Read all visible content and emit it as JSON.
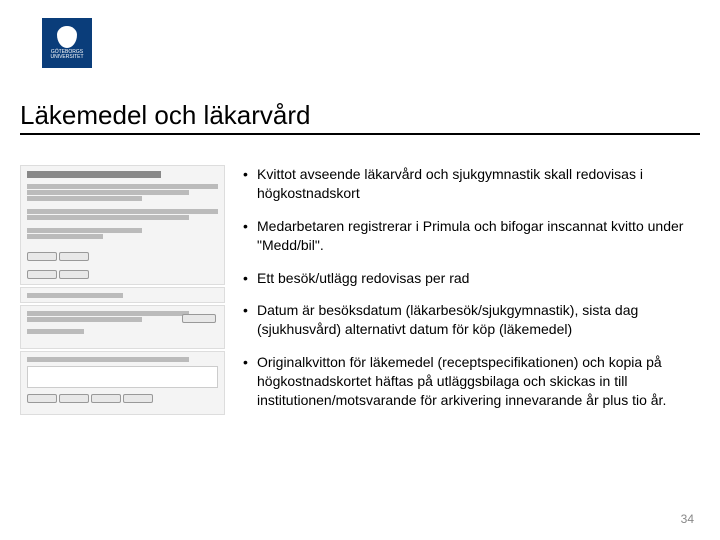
{
  "logo": {
    "line1": "GÖTEBORGS",
    "line2": "UNIVERSITET"
  },
  "title": "Läkemedel och läkarvård",
  "bullets": [
    "Kvittot avseende läkarvård och sjukgymnastik skall redovisas i högkostnadskort",
    "Medarbetaren registrerar i Primula och bifogar inscannat kvitto under \"Medd/bil\".",
    "Ett besök/utlägg redovisas per rad",
    "Datum är besöksdatum (läkarbesök/sjukgymnastik), sista dag (sjukhusvård) alternativt datum för köp (läkemedel)",
    "Originalkvitton för läkemedel (receptspecifikationen) och kopia på högkostnadskortet häftas på utläggsbilaga och skickas in till institutionen/motsvarande för arkivering innevarande år plus tio år."
  ],
  "page_number": "34"
}
